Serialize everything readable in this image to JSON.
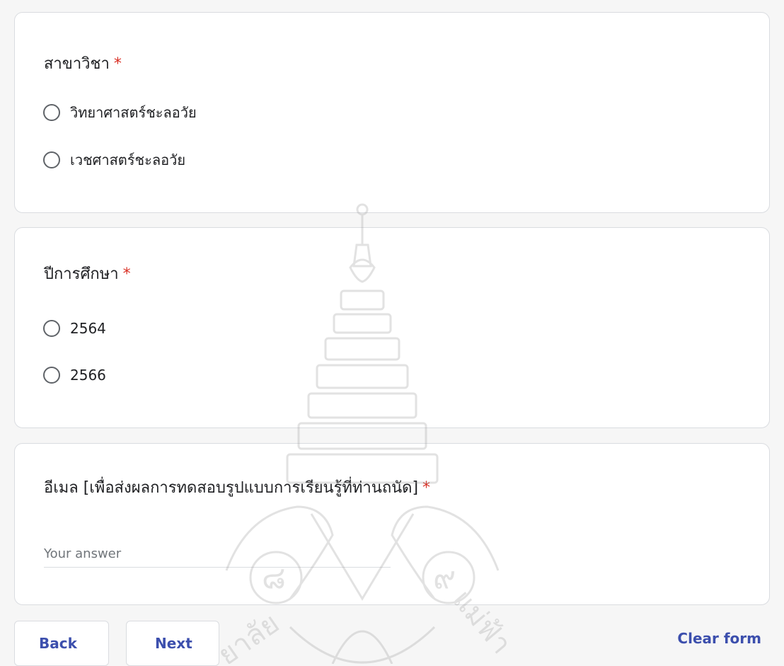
{
  "questions": [
    {
      "title": "สาขาวิชา",
      "required_mark": "*",
      "options": [
        "วิทยาศาสตร์ชะลอวัย",
        "เวชศาสตร์ชะลอวัย"
      ]
    },
    {
      "title": "ปีการศึกษา",
      "required_mark": "*",
      "options": [
        "2564",
        "2566"
      ]
    },
    {
      "title": "อีเมล [เพื่อส่งผลการทดสอบรูปแบบการเรียนรู้ที่ท่านถนัด]",
      "required_mark": "*",
      "placeholder": "Your answer"
    }
  ],
  "footer": {
    "back_label": "Back",
    "next_label": "Next",
    "clear_label": "Clear form"
  },
  "watermark_text": {
    "left_emblem": "๘",
    "right_emblem": "๙",
    "left_arc": "ยาลัย",
    "right_arc": "แม่ฟ้า"
  },
  "colors": {
    "accent": "#3c4fad",
    "required": "#d93025",
    "card_border": "#dadce0"
  }
}
